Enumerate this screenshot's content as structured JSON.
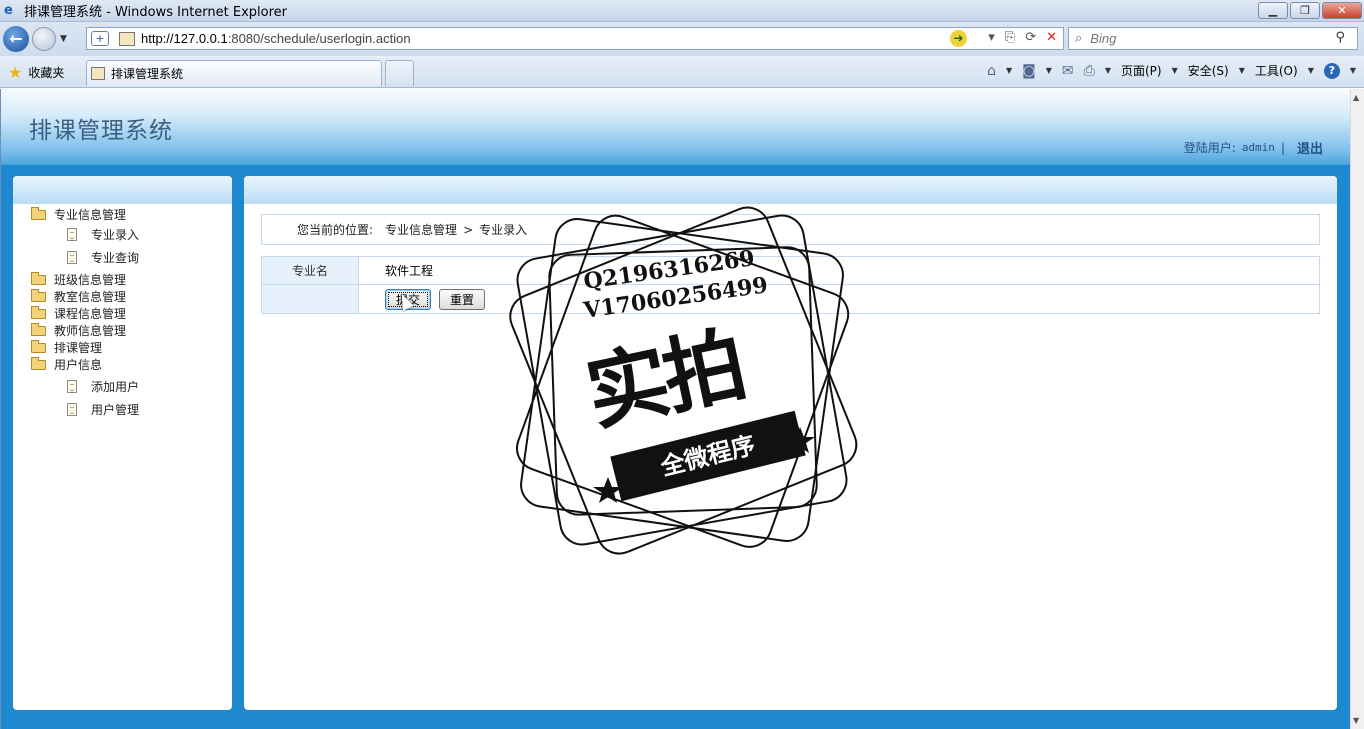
{
  "browser": {
    "window_title": "排课管理系统 - Windows Internet Explorer",
    "url_host": "http://127.0.0.1",
    "url_rest": ":8080/schedule/userlogin.action",
    "search_placeholder": "Bing",
    "favorites_label": "收藏夹",
    "tab_title": "排课管理系统",
    "menu_page": "页面(P)",
    "menu_safety": "安全(S)",
    "menu_tools": "工具(O)"
  },
  "header": {
    "app_title": "排课管理系统",
    "user_label": "登陆用户:",
    "username": "admin",
    "separator": "|",
    "logout": "退出"
  },
  "sidebar": {
    "items": [
      {
        "label": "专业信息管理",
        "children": [
          "专业录入",
          "专业查询"
        ]
      },
      {
        "label": "班级信息管理"
      },
      {
        "label": "教室信息管理"
      },
      {
        "label": "课程信息管理"
      },
      {
        "label": "教师信息管理"
      },
      {
        "label": "排课管理"
      },
      {
        "label": "用户信息",
        "children": [
          "添加用户",
          "用户管理"
        ]
      }
    ]
  },
  "main": {
    "location_label": "您当前的位置:",
    "crumb1": "专业信息管理",
    "crumb_sep": ">",
    "crumb2": "专业录入",
    "field_label": "专业名",
    "field_value": "软件工程",
    "submit_label": "提交",
    "reset_label": "重置"
  },
  "watermark": {
    "line1": "Q2196316269",
    "line2": "V17060256499",
    "big": "实拍",
    "ribbon": "全微程序"
  }
}
